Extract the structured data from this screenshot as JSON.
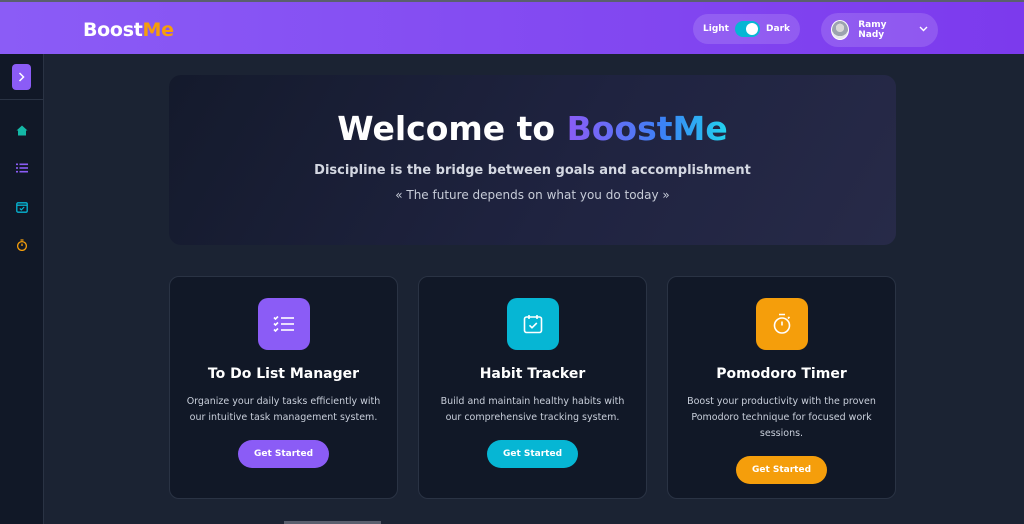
{
  "header": {
    "logo_part1": "Boost",
    "logo_part2": "Me",
    "theme_light": "Light",
    "theme_dark": "Dark",
    "user_name": "Ramy Nady"
  },
  "sidebar": {
    "toggle_icon": "chevron-right-icon",
    "items": [
      {
        "icon": "home-icon",
        "color": "#14b8a6"
      },
      {
        "icon": "list-icon",
        "color": "#8b5cf6"
      },
      {
        "icon": "calendar-check-icon",
        "color": "#06b6d4"
      },
      {
        "icon": "timer-icon",
        "color": "#f59e0b"
      }
    ]
  },
  "hero": {
    "title_prefix": "Welcome to",
    "title_brand": "BoostMe",
    "subtitle": "Discipline is the bridge between goals and accomplishment",
    "quote": "« The future depends on what you do today »"
  },
  "cards": [
    {
      "title": "To Do List Manager",
      "description": "Organize your daily tasks efficiently with our intuitive task management system.",
      "button": "Get Started",
      "color": "#8b5cf6",
      "icon": "checklist-icon"
    },
    {
      "title": "Habit Tracker",
      "description": "Build and maintain healthy habits with our comprehensive tracking system.",
      "button": "Get Started",
      "color": "#06b6d4",
      "icon": "calendar-check-icon"
    },
    {
      "title": "Pomodoro Timer",
      "description": "Boost your productivity with the proven Pomodoro technique for focused work sessions.",
      "button": "Get Started",
      "color": "#f59e0b",
      "icon": "timer-icon"
    }
  ]
}
